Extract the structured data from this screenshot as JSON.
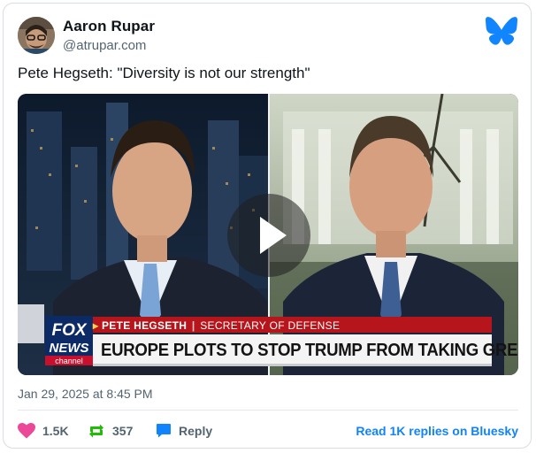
{
  "post": {
    "author_name": "Aaron Rupar",
    "author_handle": "@atrupar.com",
    "text": "Pete Hegseth: \"Diversity is not our strength\"",
    "timestamp": "Jan 29, 2025 at 8:45 PM"
  },
  "media": {
    "lower_third_name": "PETE HEGSETH",
    "lower_third_separator": "|",
    "lower_third_title": "SECRETARY OF DEFENSE",
    "headline": "EUROPE PLOTS TO STOP TRUMP FROM TAKING GREENLAND",
    "network_logo_text": [
      "FOX",
      "NEWS",
      "channel"
    ]
  },
  "actions": {
    "likes": "1.5K",
    "reposts": "357",
    "reply_label": "Reply",
    "read_replies_label": "Read 1K replies on Bluesky"
  },
  "colors": {
    "like_heart": "#ec4899",
    "repost_green": "#20bc07",
    "reply_blue": "#1083fe",
    "bluesky_blue": "#1185fe"
  },
  "icons": {
    "logo": "bluesky-butterfly-icon",
    "like": "heart-icon",
    "repost": "repost-icon",
    "reply": "speech-bubble-icon",
    "play": "play-icon"
  }
}
